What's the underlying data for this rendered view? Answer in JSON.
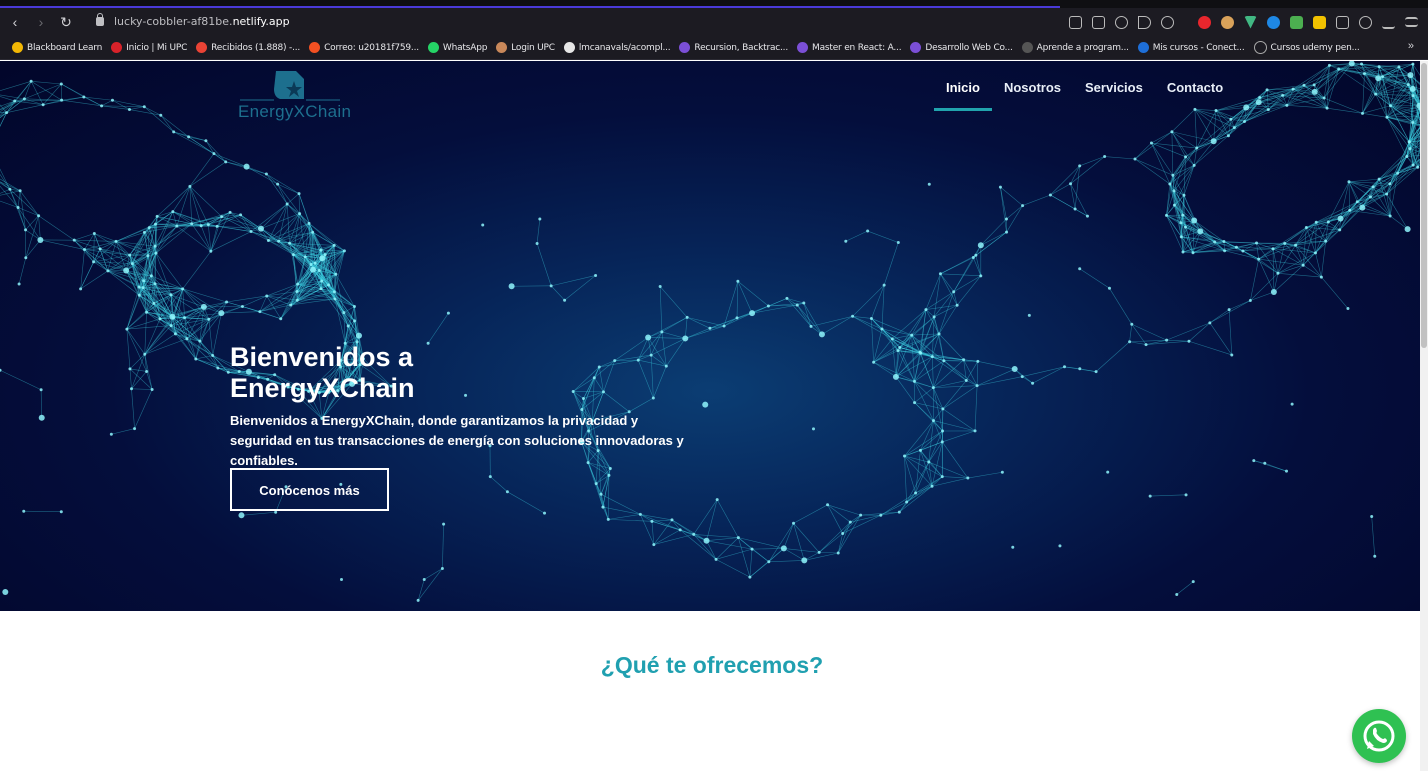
{
  "browser": {
    "url_prefix": "lucky-cobbler-af81be.",
    "url_domain": "netlify.app",
    "bookmarks": [
      {
        "label": "Blackboard Learn",
        "color": "#f2b705"
      },
      {
        "label": "Inicio | Mi UPC",
        "color": "#d8222a"
      },
      {
        "label": "Recibidos (1.888) -...",
        "color": "#ea4335"
      },
      {
        "label": "Correo: u20181f759...",
        "color": "#f25022"
      },
      {
        "label": "WhatsApp",
        "color": "#25d366"
      },
      {
        "label": "Login UPC",
        "color": "#c9885a"
      },
      {
        "label": "lmcanavals/acompl...",
        "color": "#e6e6e6"
      },
      {
        "label": "Recursion, Backtrac...",
        "color": "#7b4fd6"
      },
      {
        "label": "Master en React: A...",
        "color": "#7b4fd6"
      },
      {
        "label": "Desarrollo Web Co...",
        "color": "#7b4fd6"
      },
      {
        "label": "Aprende a program...",
        "color": "#555555"
      },
      {
        "label": "Mis cursos - Conect...",
        "color": "#1e6fd9"
      },
      {
        "label": "Cursos udemy pen...",
        "color": "#1c1b22"
      }
    ],
    "more_label": "»"
  },
  "site": {
    "logo_text": "EnergyXChain",
    "nav": [
      {
        "label": "Inicio",
        "active": true
      },
      {
        "label": "Nosotros",
        "active": false
      },
      {
        "label": "Servicios",
        "active": false
      },
      {
        "label": "Contacto",
        "active": false
      }
    ]
  },
  "hero": {
    "title": "Bienvenidos a EnergyXChain",
    "subtitle": "Bienvenidos a EnergyXChain, donde garantizamos la privacidad y seguridad en tus transacciones de energía con soluciones innovadoras y confiables.",
    "cta_label": "Conócenos más"
  },
  "services": {
    "title": "¿Qué te ofrecemos?"
  },
  "colors": {
    "accent": "#20a0b0",
    "hero_dark": "#02062a",
    "network_cyan": "#3fe2ef",
    "whatsapp_green": "#2fc152"
  },
  "icons": {
    "whatsapp": "whatsapp-icon"
  }
}
